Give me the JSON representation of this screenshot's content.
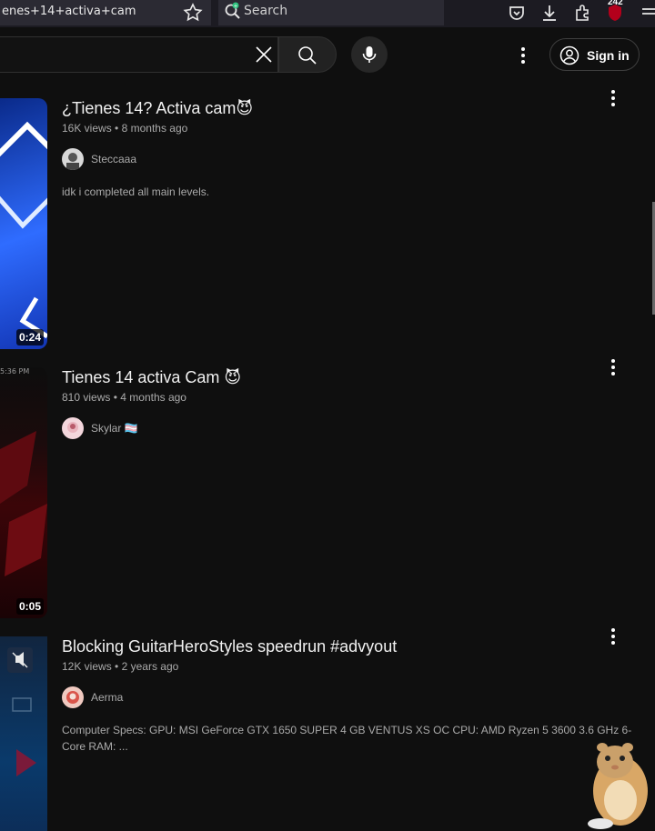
{
  "browser": {
    "url_text": "enes+14+activa+cam",
    "search_placeholder": "Search",
    "notification_count": "242"
  },
  "header": {
    "sign_in_label": "Sign in"
  },
  "results": [
    {
      "title": "¿Tienes 14? Activa cam😈",
      "views": "16K views",
      "age": "8 months ago",
      "channel": "Steccaaa",
      "description": "idk i completed all main levels.",
      "duration": "0:24"
    },
    {
      "title": "Tienes 14 activa Cam 😈",
      "views": "810 views",
      "age": "4 months ago",
      "channel": "Skylar 🏳️‍⚧️",
      "description": "",
      "duration": "0:05",
      "thumb_caption": "5:36 PM"
    },
    {
      "title": "Blocking GuitarHeroStyles speedrun #advyout",
      "views": "12K views",
      "age": "2 years ago",
      "channel": "Aerma",
      "description": "Computer Specs: GPU: MSI GeForce GTX 1650 SUPER 4 GB VENTUS XS OC CPU: AMD Ryzen 5 3600 3.6 GHz 6-Core RAM: ...",
      "duration": ""
    }
  ],
  "meta_separator": "•",
  "colors": {
    "background": "#0f0f0f",
    "text_primary": "#f1f1f1",
    "text_secondary": "#aaaaaa",
    "thumb1": "#1d4fd8",
    "thumb2": "#3a0508",
    "thumb3": "#0b2a4e"
  }
}
